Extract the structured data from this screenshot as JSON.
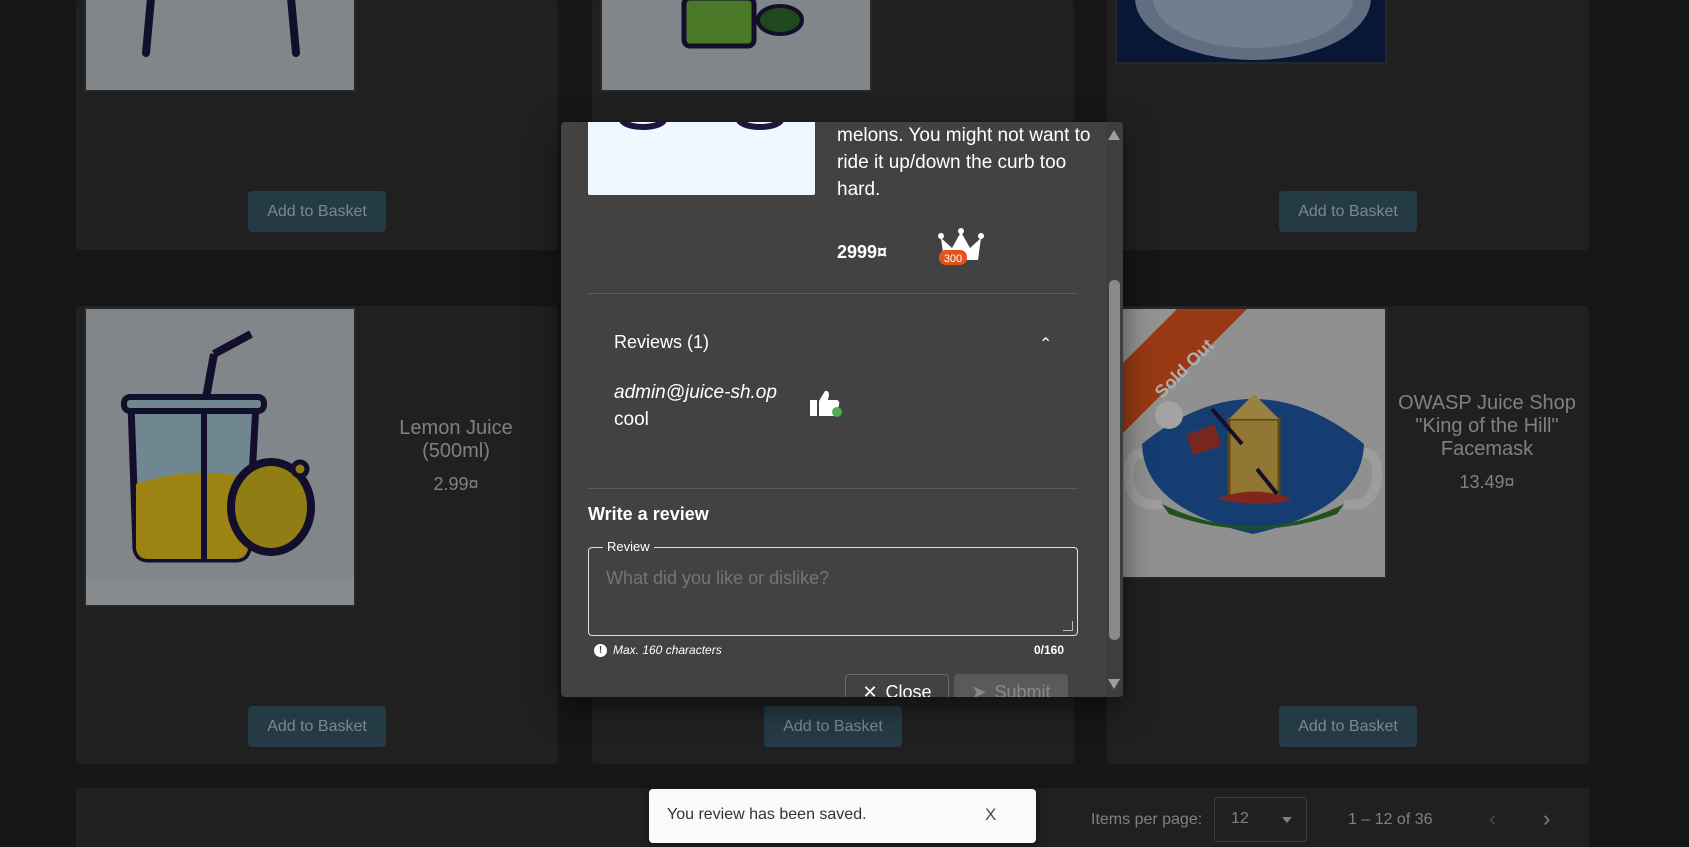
{
  "products": {
    "basket_label": "Add to Basket",
    "lemon": {
      "name": "Lemon Juice (500ml)",
      "price": "2.99¤"
    },
    "facemask": {
      "name": "OWASP Juice Shop \"King of the Hill\" Facemask",
      "price": "13.49¤",
      "ribbon": "Sold Out"
    }
  },
  "dialog": {
    "description": "melons. You might not want to ride it up/down the curb too hard.",
    "price": "2999¤",
    "badge": "300",
    "reviews_title": "Reviews (1)",
    "review": {
      "author": "admin@juice-sh.op",
      "text": "cool"
    },
    "write_title": "Write a review",
    "review_legend": "Review",
    "review_placeholder": "What did you like or dislike?",
    "hint": "Max. 160 characters",
    "counter": "0/160",
    "close_label": "Close",
    "submit_label": "Submit"
  },
  "paginator": {
    "items_per_page_label": "Items per page:",
    "items_per_page": "12",
    "range": "1 – 12 of 36"
  },
  "snackbar": {
    "message": "You review has been saved.",
    "dismiss": "X"
  },
  "colors": {
    "basket_button": "#355766",
    "ribbon": "#e0541c"
  }
}
